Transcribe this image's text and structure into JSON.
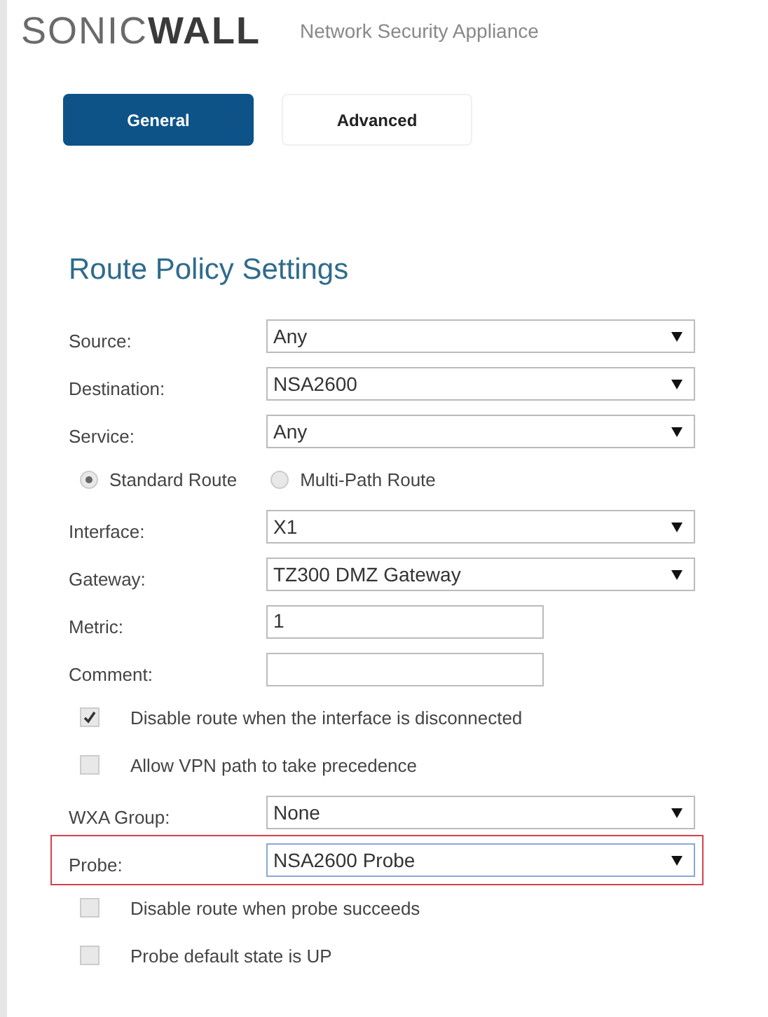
{
  "header": {
    "logo": "SONIC**WALL**",
    "product": "Network Security Appliance"
  },
  "tabs": [
    {
      "label": "General",
      "selected": true
    },
    {
      "label": "Advanced",
      "selected": false
    }
  ],
  "section_title": "Route Policy Settings",
  "rows": [
    {
      "kind": "select",
      "label": "Source:",
      "value": "Any",
      "highlighted": false
    },
    {
      "kind": "select",
      "label": "Destination:",
      "value": "NSA2600",
      "highlighted": false
    },
    {
      "kind": "select",
      "label": "Service:",
      "value": "Any",
      "highlighted": false
    },
    {
      "kind": "radios",
      "options": [
        {
          "label": "Standard Route",
          "selected": true
        },
        {
          "label": "Multi-Path Route",
          "selected": false
        }
      ]
    },
    {
      "kind": "select",
      "label": "Interface:",
      "value": "X1",
      "highlighted": false
    },
    {
      "kind": "select",
      "label": "Gateway:",
      "value": "TZ300 DMZ Gateway",
      "highlighted": false
    },
    {
      "kind": "text",
      "label": "Metric:",
      "value": "1"
    },
    {
      "kind": "text",
      "label": "Comment:",
      "value": ""
    },
    {
      "kind": "checkbox",
      "label": "Disable route when the interface is disconnected",
      "checked": true
    },
    {
      "kind": "checkbox",
      "label": "Allow VPN path to take precedence",
      "checked": false
    },
    {
      "kind": "select",
      "label": "WXA Group:",
      "value": "None",
      "highlighted": false
    },
    {
      "kind": "select",
      "label": "Probe:",
      "value": "NSA2600 Probe",
      "highlighted": true
    },
    {
      "kind": "checkbox",
      "label": "Disable route when probe succeeds",
      "checked": false
    },
    {
      "kind": "checkbox",
      "label": "Probe default state is UP",
      "checked": false
    }
  ]
}
